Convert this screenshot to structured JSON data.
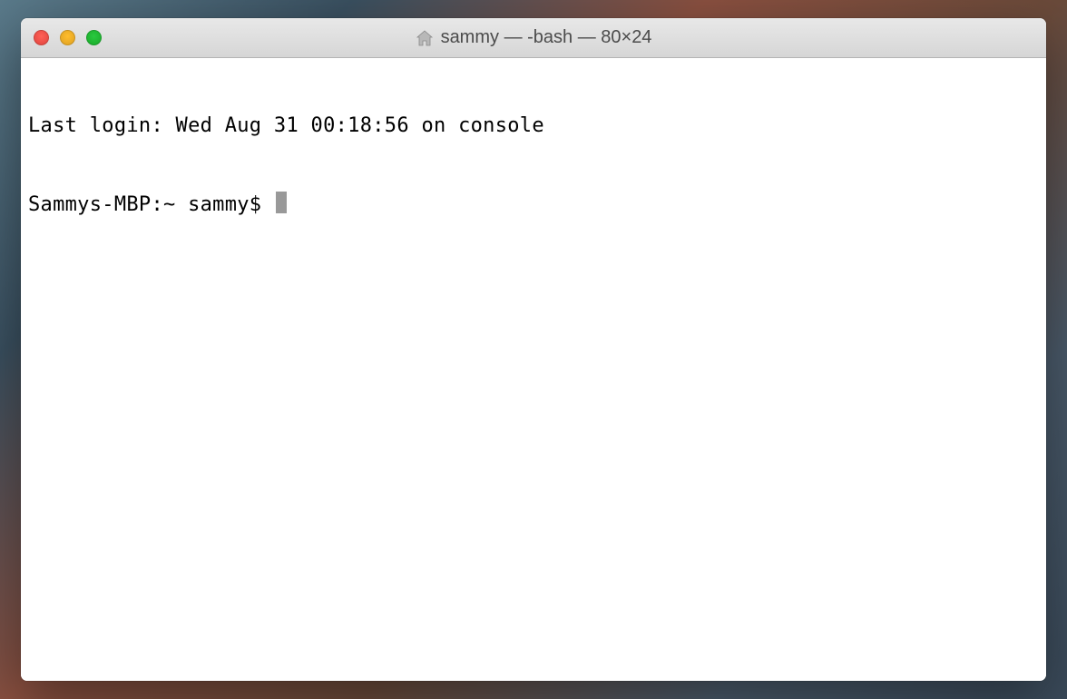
{
  "titlebar": {
    "title": "sammy — -bash — 80×24",
    "icon": "home-folder-icon"
  },
  "terminal": {
    "line1": "Last login: Wed Aug 31 00:18:56 on console",
    "prompt": "Sammys-MBP:~ sammy$ "
  }
}
